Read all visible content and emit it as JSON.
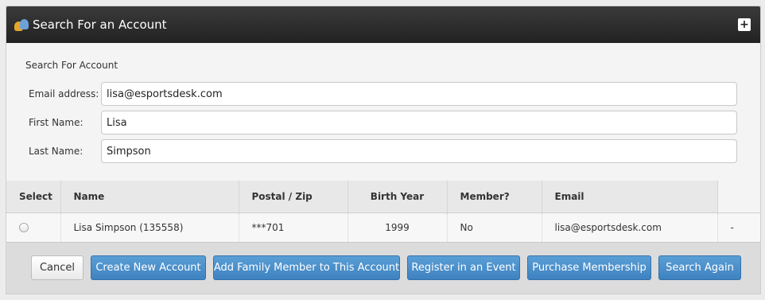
{
  "header": {
    "title": "Search For an Account",
    "expand_symbol": "+"
  },
  "form": {
    "section_title": "Search For Account",
    "fields": [
      {
        "label": "Email address:",
        "value": "lisa@esportsdesk.com"
      },
      {
        "label": "First Name:",
        "value": "Lisa"
      },
      {
        "label": "Last Name:",
        "value": "Simpson"
      }
    ]
  },
  "table": {
    "headers": [
      "Select",
      "Name",
      "Postal / Zip",
      "Birth Year",
      "Member?",
      "Email"
    ],
    "rows": [
      {
        "name": "Lisa Simpson (135558)",
        "postal": "***701",
        "birth_year": "1999",
        "member": "No",
        "email": "lisa@esportsdesk.com",
        "extra": "-"
      }
    ]
  },
  "footer": {
    "cancel": "Cancel",
    "create_account": "Create New Account",
    "add_family": "Add Family Member to This Account",
    "register_event": "Register in an Event",
    "purchase_membership": "Purchase Membership",
    "search_again": "Search Again"
  },
  "colors": {
    "header_bg": "#2b2b2b",
    "primary_button": "#4a8ecb",
    "panel_bg": "#f4f4f4"
  },
  "icons": {
    "header_icon": "users-icon",
    "expand_icon": "plus-icon"
  }
}
